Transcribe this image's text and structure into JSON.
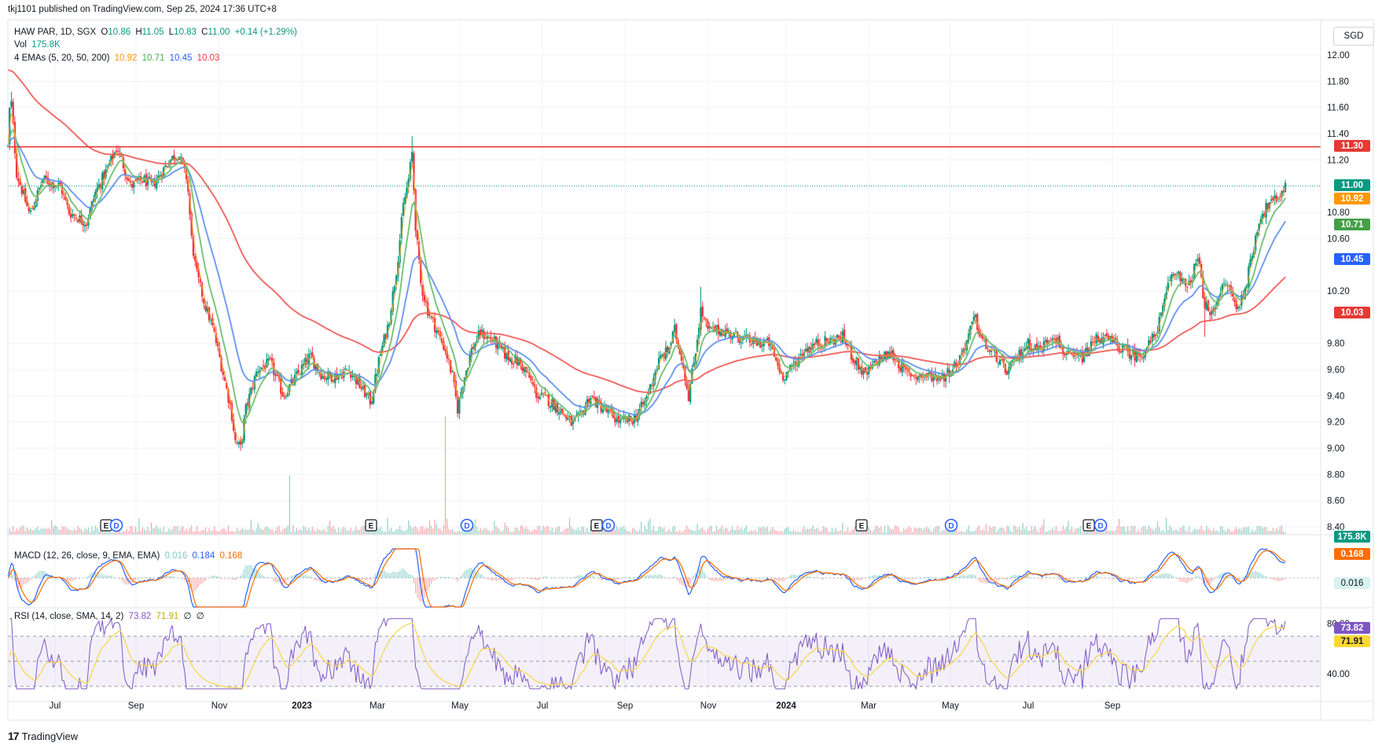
{
  "publish_line": "tkj1101 published on TradingView.com, Sep 25, 2024 17:36 UTC+8",
  "legend": {
    "symbol": "HAW PAR, 1D, SGX",
    "o_label": "O",
    "o": "10.86",
    "h_label": "H",
    "h": "11.05",
    "l_label": "L",
    "l": "10.83",
    "c_label": "C",
    "c": "11.00",
    "chg": "+0.14 (+1.29%)",
    "vol_label": "Vol",
    "vol": "175.8K",
    "ema_label": "4 EMAs (5, 20, 50, 200)",
    "ema5": "10.92",
    "ema20": "10.71",
    "ema50": "10.45",
    "ema200": "10.03",
    "macd_label": "MACD (12, 26, close, 9, EMA, EMA)",
    "macd_hist": "0.016",
    "macd_line": "0.184",
    "macd_signal": "0.168",
    "rsi_label": "RSI (14, close, SMA, 14, 2)",
    "rsi": "73.82",
    "rsi_ma": "71.91",
    "rsi_x1": "∅",
    "rsi_x2": "∅"
  },
  "currency": "SGD",
  "footer_logo": "17",
  "footer_text": "TradingView",
  "colors": {
    "up": "#089981",
    "down": "#f23645",
    "ema5": "#ff9800",
    "ema20": "#4caf50",
    "ema50": "#2962ff",
    "ema200": "#f23645",
    "hline": "#e53935",
    "rsi": "#7e57c2",
    "rsi_ma": "#fdd835"
  },
  "tags": {
    "hline": "11.30",
    "last": "11.00",
    "ema5": "10.92",
    "ema20": "10.71",
    "ema50": "10.45",
    "ema200": "10.03",
    "vol": "175.8K",
    "macd_signal": "0.168",
    "macd_hist": "0.016",
    "rsi": "73.82",
    "rsi_ma": "71.91"
  },
  "chart_data": {
    "type": "candlestick",
    "price_axis": {
      "min": 8.4,
      "max": 12.0,
      "ticks": [
        "12.00",
        "11.80",
        "11.60",
        "11.40",
        "11.20",
        "10.80",
        "10.60",
        "10.20",
        "9.80",
        "9.60",
        "9.40",
        "9.20",
        "9.00",
        "8.80",
        "8.60",
        "8.40"
      ]
    },
    "rsi_axis": {
      "ticks": [
        "80.00",
        "40.00"
      ],
      "bands": [
        70,
        30
      ]
    },
    "x_labels": [
      "Jul",
      "Sep",
      "Nov",
      "2023",
      "Mar",
      "May",
      "Jul",
      "Sep",
      "Nov",
      "2024",
      "Mar",
      "May",
      "Jul",
      "Sep"
    ],
    "horizontal_line": 11.3,
    "last_price": 11.0,
    "events": [
      {
        "date": "Aug 2022",
        "marks": [
          "E",
          "D"
        ]
      },
      {
        "date": "Feb 2023",
        "marks": [
          "E"
        ]
      },
      {
        "date": "Apr 2023",
        "marks": [
          "D"
        ]
      },
      {
        "date": "Aug 2023",
        "marks": [
          "E",
          "D"
        ]
      },
      {
        "date": "Feb 2024",
        "marks": [
          "E"
        ]
      },
      {
        "date": "Apr 2024",
        "marks": [
          "D"
        ]
      },
      {
        "date": "Aug 2024",
        "marks": [
          "E",
          "D"
        ]
      }
    ],
    "keypoints": [
      [
        0,
        11.3
      ],
      [
        3,
        11.72
      ],
      [
        10,
        11.1
      ],
      [
        25,
        10.78
      ],
      [
        40,
        11.05
      ],
      [
        60,
        11.0
      ],
      [
        70,
        10.8
      ],
      [
        90,
        10.72
      ],
      [
        100,
        10.95
      ],
      [
        115,
        11.15
      ],
      [
        125,
        11.3
      ],
      [
        130,
        11.2
      ],
      [
        140,
        11.0
      ],
      [
        155,
        11.05
      ],
      [
        165,
        11.0
      ],
      [
        175,
        11.1
      ],
      [
        185,
        11.2
      ],
      [
        195,
        11.25
      ],
      [
        205,
        11.05
      ],
      [
        210,
        10.6
      ],
      [
        215,
        10.35
      ],
      [
        225,
        10.1
      ],
      [
        235,
        9.9
      ],
      [
        245,
        9.6
      ],
      [
        255,
        9.3
      ],
      [
        260,
        9.05
      ],
      [
        266,
        9.0
      ],
      [
        272,
        9.3
      ],
      [
        285,
        9.6
      ],
      [
        300,
        9.65
      ],
      [
        315,
        9.4
      ],
      [
        330,
        9.55
      ],
      [
        345,
        9.7
      ],
      [
        360,
        9.55
      ],
      [
        375,
        9.55
      ],
      [
        390,
        9.6
      ],
      [
        405,
        9.45
      ],
      [
        415,
        9.35
      ],
      [
        425,
        9.7
      ],
      [
        435,
        9.95
      ],
      [
        445,
        10.4
      ],
      [
        452,
        10.85
      ],
      [
        458,
        11.05
      ],
      [
        462,
        11.25
      ],
      [
        466,
        10.7
      ],
      [
        472,
        10.25
      ],
      [
        480,
        10.05
      ],
      [
        490,
        9.9
      ],
      [
        500,
        9.75
      ],
      [
        508,
        9.55
      ],
      [
        514,
        9.3
      ],
      [
        520,
        9.5
      ],
      [
        530,
        9.75
      ],
      [
        540,
        9.88
      ],
      [
        555,
        9.82
      ],
      [
        570,
        9.7
      ],
      [
        585,
        9.65
      ],
      [
        595,
        9.55
      ],
      [
        605,
        9.4
      ],
      [
        615,
        9.38
      ],
      [
        630,
        9.3
      ],
      [
        645,
        9.18
      ],
      [
        655,
        9.25
      ],
      [
        665,
        9.4
      ],
      [
        675,
        9.33
      ],
      [
        690,
        9.25
      ],
      [
        700,
        9.2
      ],
      [
        715,
        9.22
      ],
      [
        728,
        9.35
      ],
      [
        738,
        9.55
      ],
      [
        745,
        9.68
      ],
      [
        755,
        9.75
      ],
      [
        762,
        9.9
      ],
      [
        770,
        9.7
      ],
      [
        778,
        9.4
      ],
      [
        785,
        9.7
      ],
      [
        792,
        10.05
      ],
      [
        800,
        9.9
      ],
      [
        815,
        9.9
      ],
      [
        835,
        9.85
      ],
      [
        855,
        9.8
      ],
      [
        870,
        9.8
      ],
      [
        885,
        9.55
      ],
      [
        895,
        9.6
      ],
      [
        910,
        9.75
      ],
      [
        925,
        9.8
      ],
      [
        940,
        9.82
      ],
      [
        955,
        9.85
      ],
      [
        965,
        9.7
      ],
      [
        980,
        9.55
      ],
      [
        995,
        9.68
      ],
      [
        1010,
        9.72
      ],
      [
        1025,
        9.58
      ],
      [
        1040,
        9.55
      ],
      [
        1055,
        9.55
      ],
      [
        1070,
        9.55
      ],
      [
        1085,
        9.65
      ],
      [
        1095,
        9.8
      ],
      [
        1105,
        10.0
      ],
      [
        1112,
        9.85
      ],
      [
        1120,
        9.75
      ],
      [
        1130,
        9.7
      ],
      [
        1140,
        9.58
      ],
      [
        1150,
        9.65
      ],
      [
        1165,
        9.8
      ],
      [
        1180,
        9.75
      ],
      [
        1195,
        9.88
      ],
      [
        1205,
        9.75
      ],
      [
        1215,
        9.68
      ],
      [
        1230,
        9.7
      ],
      [
        1245,
        9.85
      ],
      [
        1260,
        9.82
      ],
      [
        1275,
        9.75
      ],
      [
        1290,
        9.7
      ],
      [
        1300,
        9.75
      ],
      [
        1310,
        9.85
      ],
      [
        1320,
        10.05
      ],
      [
        1328,
        10.3
      ],
      [
        1338,
        10.35
      ],
      [
        1348,
        10.2
      ],
      [
        1360,
        10.45
      ],
      [
        1368,
        10.1
      ],
      [
        1375,
        10.0
      ],
      [
        1385,
        10.2
      ],
      [
        1395,
        10.25
      ],
      [
        1405,
        10.05
      ],
      [
        1413,
        10.2
      ],
      [
        1420,
        10.4
      ],
      [
        1430,
        10.75
      ],
      [
        1440,
        10.85
      ],
      [
        1450,
        10.9
      ],
      [
        1460,
        11.0
      ]
    ]
  }
}
